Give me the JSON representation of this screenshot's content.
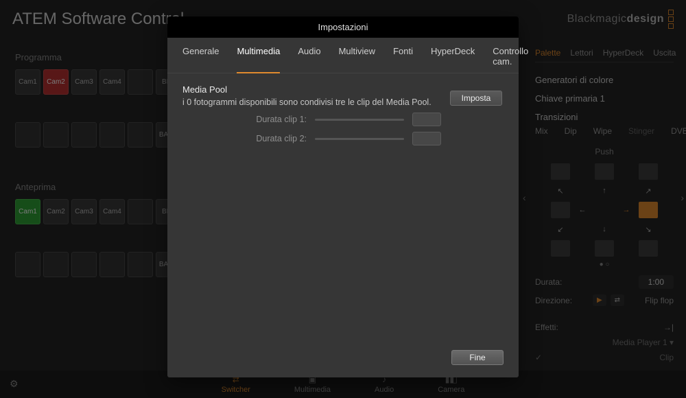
{
  "app": {
    "title": "ATEM Software Control",
    "brand_a": "Blackmagic",
    "brand_b": "design"
  },
  "program": {
    "label": "Programma",
    "row1": [
      "Cam1",
      "Cam2",
      "Cam3",
      "Cam4",
      "",
      "BLK"
    ],
    "row2": [
      "",
      "",
      "",
      "",
      "",
      "BARS"
    ]
  },
  "preview": {
    "label": "Anteprima",
    "row1": [
      "Cam1",
      "Cam2",
      "Cam3",
      "Cam4",
      "",
      "BLK"
    ],
    "row2": [
      "",
      "",
      "",
      "",
      "",
      "BARS"
    ]
  },
  "right": {
    "tabs": [
      "Palette",
      "Lettori",
      "HyperDeck",
      "Uscita"
    ],
    "gen": "Generatori di colore",
    "key": "Chiave primaria 1",
    "trans": "Transizioni",
    "trans_types": [
      "Mix",
      "Dip",
      "Wipe",
      "Stinger",
      "DVE"
    ],
    "push": "Push",
    "durata_k": "Durata:",
    "durata_v": "1:00",
    "dir_k": "Direzione:",
    "flip": "Flip flop",
    "eff_k": "Effetti:",
    "media": "Media Player 1",
    "clip": "Clip",
    "arrows": {
      "nw": "↖",
      "n": "↑",
      "ne": "↗",
      "w": "←",
      "e": "→",
      "sw": "↙",
      "s": "↓",
      "se": "↘"
    }
  },
  "bottom": {
    "switcher": "Switcher",
    "media": "Multimedia",
    "audio": "Audio",
    "camera": "Camera"
  },
  "modal": {
    "title": "Impostazioni",
    "tabs": [
      "Generale",
      "Multimedia",
      "Audio",
      "Multiview",
      "Fonti",
      "HyperDeck",
      "Controllo cam."
    ],
    "active_tab": 1,
    "section": "Media Pool",
    "desc": "i 0 fotogrammi disponibili sono condivisi tre le clip del Media Pool.",
    "set": "Imposta",
    "clip1": "Durata clip 1:",
    "clip2": "Durata clip 2:",
    "done": "Fine"
  }
}
